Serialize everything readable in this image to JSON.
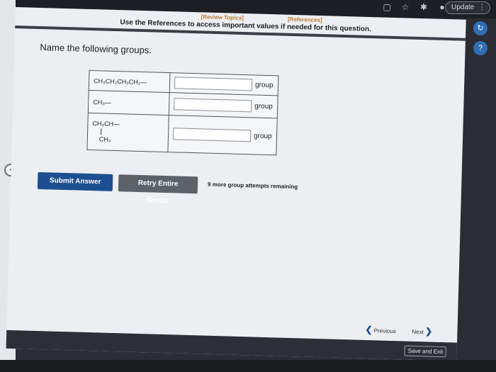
{
  "browser": {
    "update_label": "Update",
    "menu_glyph": "⋮",
    "icons": [
      "extensions-icon",
      "star-icon",
      "puzzle-icon",
      "profile-icon"
    ]
  },
  "header": {
    "review_topics": "[Review Topics]",
    "references": "[References]",
    "instructions": "Use the References to access important values if needed for this question."
  },
  "question": {
    "prompt": "Name the following groups.",
    "rows": [
      {
        "formula": "CH₃CH₂CH₂CH₂—",
        "value": "",
        "suffix": "group"
      },
      {
        "formula": "CH₃—",
        "value": "",
        "suffix": "group"
      },
      {
        "formula_top": "CH₃CH—",
        "formula_bottom": "CH₃",
        "value": "",
        "suffix": "group"
      }
    ]
  },
  "actions": {
    "submit_label": "Submit Answer",
    "retry_label": "Retry Entire Group",
    "attempts_text": "9 more group attempts remaining"
  },
  "nav": {
    "previous_label": "Previous",
    "next_label": "Next",
    "save_exit_label": "Save and Exit"
  },
  "side": {
    "refresh_glyph": "↻",
    "help_glyph": "?"
  },
  "colors": {
    "primary_button": "#1c4f91",
    "secondary_button": "#5d6168",
    "link": "#c07a30"
  }
}
